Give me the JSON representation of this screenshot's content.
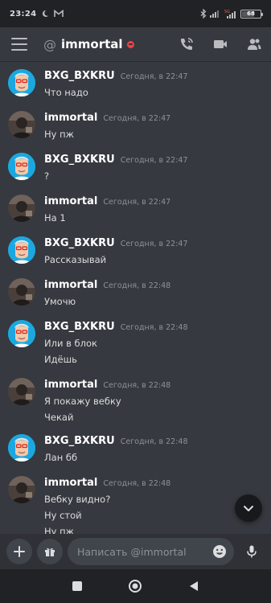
{
  "status_bar": {
    "time": "23:24",
    "network_label": "5G",
    "battery_text": "68",
    "battery_level": 0.68
  },
  "header": {
    "channel_name": "immortal",
    "status": "dnd"
  },
  "messages": [
    {
      "author": "BXG_BXKRU",
      "timestamp": "Сегодня, в 22:47",
      "avatar": "bxg",
      "lines": [
        "Что надо"
      ]
    },
    {
      "author": "immortal",
      "timestamp": "Сегодня, в 22:47",
      "avatar": "imm",
      "lines": [
        "Ну пж"
      ]
    },
    {
      "author": "BXG_BXKRU",
      "timestamp": "Сегодня, в 22:47",
      "avatar": "bxg",
      "lines": [
        "?"
      ]
    },
    {
      "author": "immortal",
      "timestamp": "Сегодня, в 22:47",
      "avatar": "imm",
      "lines": [
        "На 1"
      ]
    },
    {
      "author": "BXG_BXKRU",
      "timestamp": "Сегодня, в 22:47",
      "avatar": "bxg",
      "lines": [
        "Рассказывай"
      ]
    },
    {
      "author": "immortal",
      "timestamp": "Сегодня, в 22:48",
      "avatar": "imm",
      "lines": [
        "Умочю"
      ]
    },
    {
      "author": "BXG_BXKRU",
      "timestamp": "Сегодня, в 22:48",
      "avatar": "bxg",
      "lines": [
        "Или в блок",
        "Идёшь"
      ]
    },
    {
      "author": "immortal",
      "timestamp": "Сегодня, в 22:48",
      "avatar": "imm",
      "lines": [
        "Я покажу вебку",
        "Чекай"
      ]
    },
    {
      "author": "BXG_BXKRU",
      "timestamp": "Сегодня, в 22:48",
      "avatar": "bxg",
      "lines": [
        "Лан бб"
      ]
    },
    {
      "author": "immortal",
      "timestamp": "Сегодня, в 22:48",
      "avatar": "imm",
      "lines": [
        "Вебку видно?",
        "Ну стой",
        "Ну пж"
      ]
    }
  ],
  "composer": {
    "placeholder": "Написать @immortal"
  },
  "colors": {
    "background": "#36393f",
    "bars": "#202225",
    "input": "#40444b",
    "dnd": "#ed4245",
    "bxg_avatar": "#1ba8e0"
  }
}
